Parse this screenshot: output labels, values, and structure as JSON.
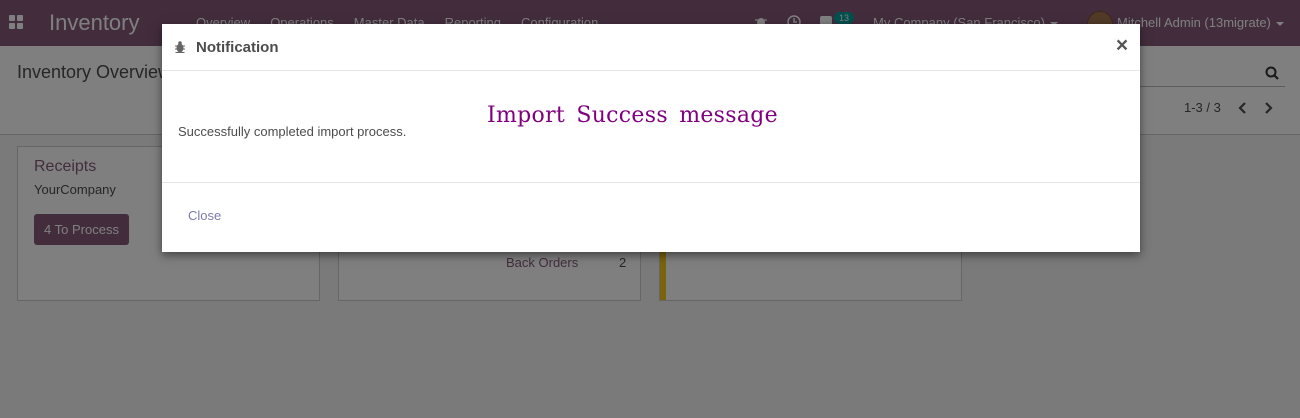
{
  "navbar": {
    "app_name": "Inventory",
    "menu": [
      "Overview",
      "Operations",
      "Master Data",
      "Reporting",
      "Configuration"
    ],
    "chat_count": "13",
    "company": "My Company (San Francisco)",
    "user": "Mitchell Admin (13migrate)"
  },
  "control_panel": {
    "title": "Inventory Overview",
    "pager": "1-3 / 3"
  },
  "cards": {
    "receipts": {
      "title": "Receipts",
      "company": "YourCompany",
      "process_button": "4 To Process"
    },
    "second": {
      "backorders_label": "Back Orders",
      "backorders_count": "2"
    }
  },
  "modal": {
    "title": "Notification",
    "message": "Successfully completed import process.",
    "heading": "Import Success message",
    "close_label": "Close",
    "close_symbol": "×"
  },
  "colors": {
    "brand": "#875a7b",
    "heading": "#800080",
    "link": "#7c7bad",
    "badge": "#00a09d",
    "kanban_strip": "#f4c719"
  }
}
